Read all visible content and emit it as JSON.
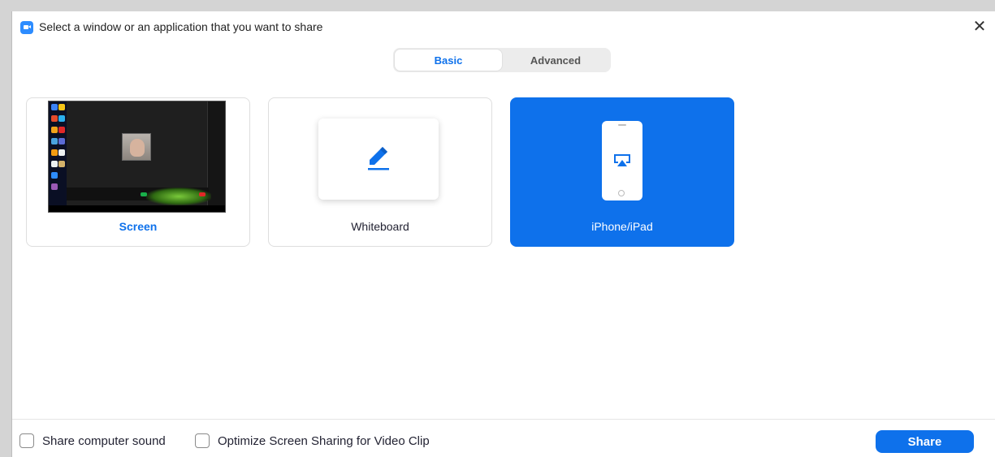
{
  "window": {
    "title": "Select a window or an application that you want to share",
    "close_glyph": "✕"
  },
  "tabs": [
    {
      "label": "Basic",
      "active": true
    },
    {
      "label": "Advanced",
      "active": false
    }
  ],
  "cards": [
    {
      "label": "Screen",
      "icon": "screen-thumbnail"
    },
    {
      "label": "Whiteboard",
      "icon": "pencil-icon"
    },
    {
      "label": "iPhone/iPad",
      "icon": "iphone-airplay-icon",
      "selected": true
    }
  ],
  "footer": {
    "share_sound_label": "Share computer sound",
    "optimize_label": "Optimize Screen Sharing for Video Clip",
    "share_button_label": "Share"
  },
  "colors": {
    "accent": "#0e71eb",
    "zoom_icon": "#2d8cff"
  }
}
